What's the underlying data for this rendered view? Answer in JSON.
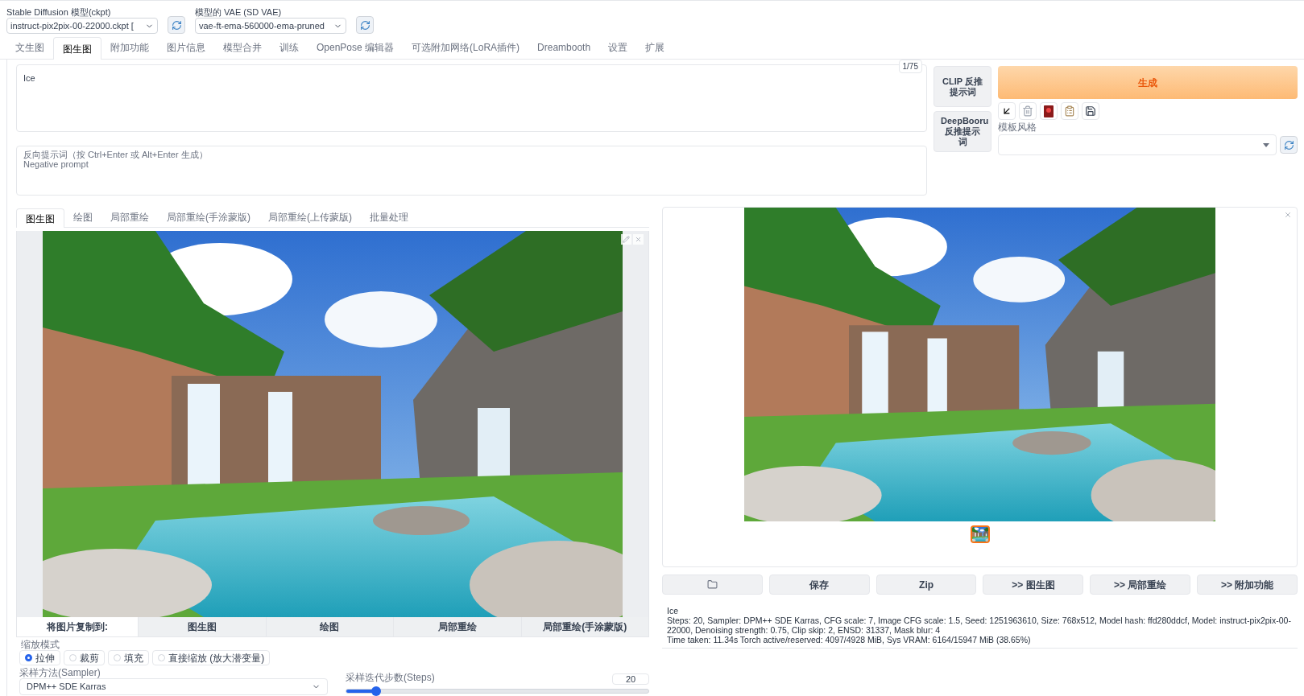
{
  "model_selectors": [
    {
      "label": "Stable Diffusion 模型(ckpt)",
      "value": "instruct-pix2pix-00-22000.ckpt ["
    },
    {
      "label": "模型的 VAE (SD VAE)",
      "value": "vae-ft-ema-560000-ema-pruned"
    }
  ],
  "main_tabs": [
    {
      "label": "文生图",
      "selected": false
    },
    {
      "label": "图生图",
      "selected": true
    },
    {
      "label": "附加功能",
      "selected": false
    },
    {
      "label": "图片信息",
      "selected": false
    },
    {
      "label": "模型合并",
      "selected": false
    },
    {
      "label": "训练",
      "selected": false
    },
    {
      "label": "OpenPose 编辑器",
      "selected": false
    },
    {
      "label": "可选附加网络(LoRA插件)",
      "selected": false
    },
    {
      "label": "Dreambooth",
      "selected": false
    },
    {
      "label": "设置",
      "selected": false
    },
    {
      "label": "扩展",
      "selected": false
    }
  ],
  "prompt": {
    "value": "Ice",
    "token_count": "1/75"
  },
  "negative_prompt": {
    "placeholder": "反向提示词（按 Ctrl+Enter 或 Alt+Enter 生成）\nNegative prompt"
  },
  "interrogate_buttons": [
    "CLIP 反推提示词",
    "DeepBooru 反推提示词"
  ],
  "generate_button": "生成",
  "styles": {
    "label": "模板风格"
  },
  "image_tabs": [
    {
      "label": "图生图",
      "selected": true
    },
    {
      "label": "绘图",
      "selected": false
    },
    {
      "label": "局部重绘",
      "selected": false
    },
    {
      "label": "局部重绘(手涂蒙版)",
      "selected": false
    },
    {
      "label": "局部重绘(上传蒙版)",
      "selected": false
    },
    {
      "label": "批量处理",
      "selected": false
    }
  ],
  "copy_to": {
    "label": "将图片复制到:",
    "buttons": [
      "图生图",
      "绘图",
      "局部重绘",
      "局部重绘(手涂蒙版)"
    ]
  },
  "resize_mode": {
    "label": "缩放模式",
    "options": [
      {
        "label": "拉伸",
        "selected": true
      },
      {
        "label": "裁剪",
        "selected": false
      },
      {
        "label": "填充",
        "selected": false
      },
      {
        "label": "直接缩放 (放大潜变量)",
        "selected": false
      }
    ]
  },
  "sampler": {
    "label": "采样方法(Sampler)",
    "value": "DPM++ SDE Karras"
  },
  "steps": {
    "label": "采样迭代步数(Steps)",
    "value": "20",
    "level": 0.1
  },
  "output_buttons": [
    {
      "kind": "folder"
    },
    {
      "kind": "text",
      "label": "保存"
    },
    {
      "kind": "text",
      "label": "Zip"
    },
    {
      "kind": "text",
      "label": ">> 图生图"
    },
    {
      "kind": "text",
      "label": ">> 局部重绘"
    },
    {
      "kind": "text",
      "label": ">> 附加功能"
    }
  ],
  "info": {
    "prompt": "Ice",
    "params": "Steps: 20, Sampler: DPM++ SDE Karras, CFG scale: 7, Image CFG scale: 1.5, Seed: 1251963610, Size: 768x512, Model hash: ffd280ddcf, Model: instruct-pix2pix-00-22000, Denoising strength: 0.75, Clip skip: 2, ENSD: 31337, Mask blur: 4",
    "timing": "Time taken: 11.34s Torch active/reserved: 4097/4928 MiB, Sys VRAM: 6164/15947 MiB (38.65%)"
  }
}
